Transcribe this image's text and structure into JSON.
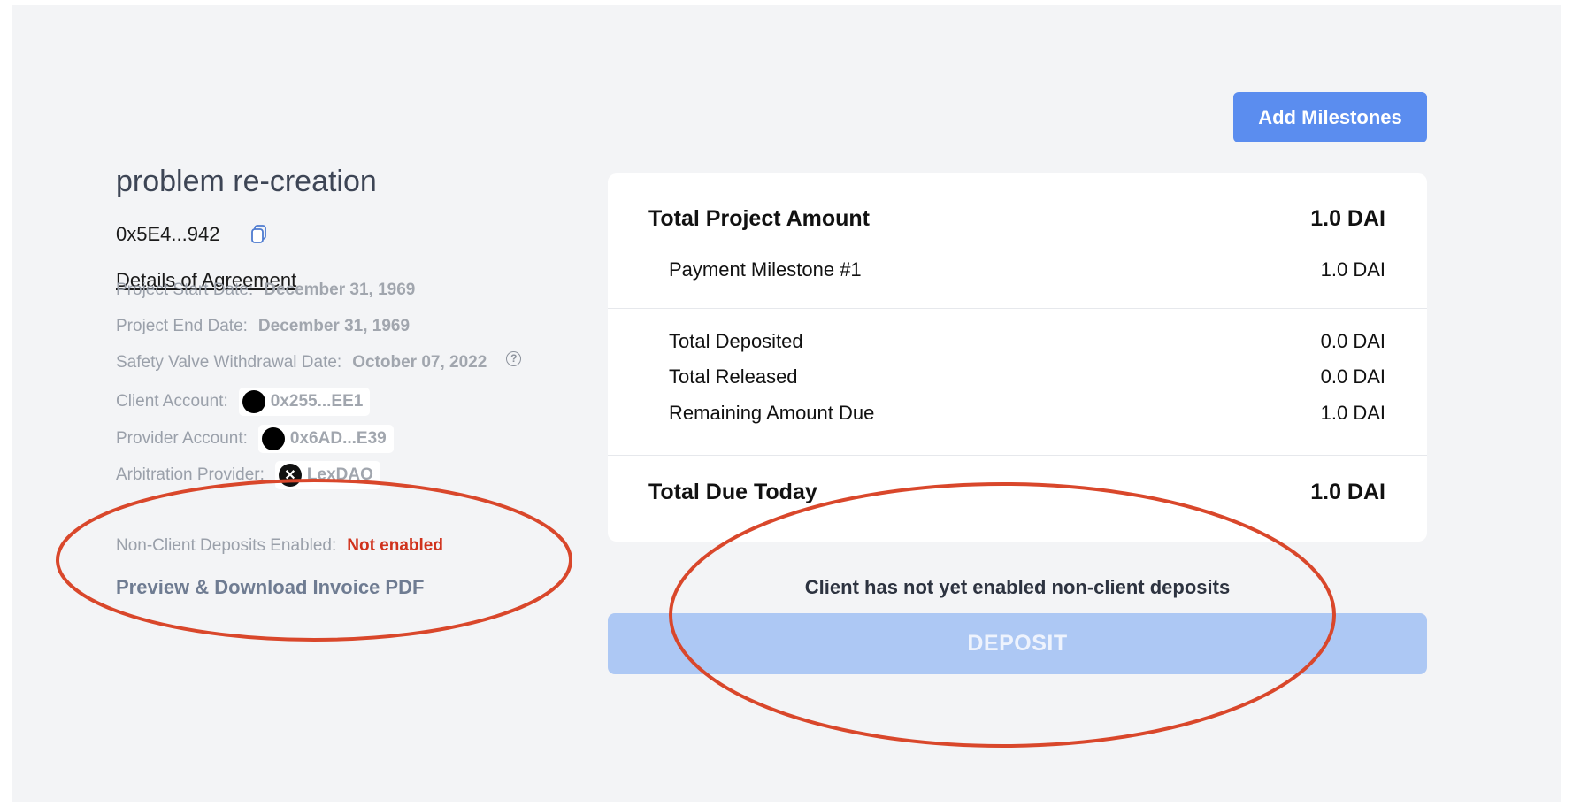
{
  "header": {
    "add_milestones_label": "Add Milestones"
  },
  "project": {
    "title": "problem re-creation",
    "address": "0x5E4...942",
    "details_link": "Details of Agreement"
  },
  "details": {
    "start_label": "Project Start Date:",
    "start_value": "December 31, 1969",
    "end_label": "Project End Date:",
    "end_value": "December 31, 1969",
    "safety_label": "Safety Valve Withdrawal Date:",
    "safety_value": "October 07, 2022",
    "client_label": "Client Account:",
    "client_value": "0x255...EE1",
    "provider_label": "Provider Account:",
    "provider_value": "0x6AD...E39",
    "arbitration_label": "Arbitration Provider:",
    "arbitration_value": "LexDAO",
    "nonclient_label": "Non-Client Deposits Enabled:",
    "nonclient_value": "Not enabled",
    "download_label": "Preview & Download Invoice PDF"
  },
  "summary": {
    "total_project_label": "Total Project Amount",
    "total_project_value": "1.0 DAI",
    "milestone_label": "Payment Milestone #1",
    "milestone_value": "1.0 DAI",
    "deposited_label": "Total Deposited",
    "deposited_value": "0.0 DAI",
    "released_label": "Total Released",
    "released_value": "0.0 DAI",
    "remaining_label": "Remaining Amount Due",
    "remaining_value": "1.0 DAI",
    "due_today_label": "Total Due Today",
    "due_today_value": "1.0 DAI"
  },
  "deposit": {
    "notice": "Client has not yet enabled non-client deposits",
    "button_label": "DEPOSIT"
  },
  "colors": {
    "accent": "#5b8def",
    "deposit_disabled": "#adc8f4",
    "not_enabled": "#d0321c",
    "annotation": "#d9472b"
  },
  "icons": {
    "copy": "copy-icon",
    "help": "help-icon",
    "arbitration": "lexdao-icon"
  }
}
